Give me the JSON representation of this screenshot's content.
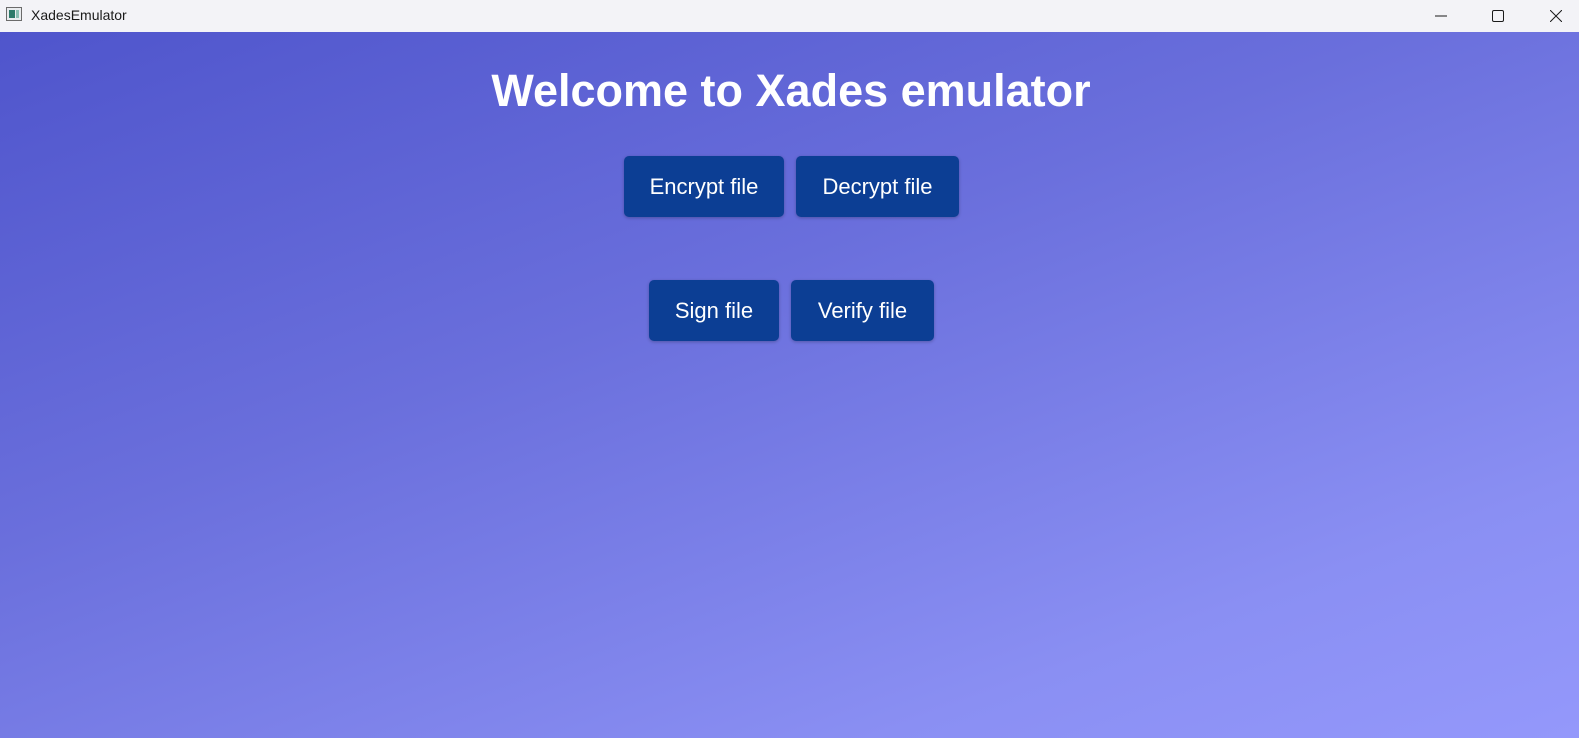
{
  "window": {
    "title": "XadesEmulator",
    "controls": {
      "minimize_icon": "minimize-icon",
      "maximize_icon": "maximize-icon",
      "close_icon": "close-icon"
    }
  },
  "main": {
    "heading": "Welcome to Xades emulator",
    "buttons": {
      "encrypt": "Encrypt file",
      "decrypt": "Decrypt file",
      "sign": "Sign file",
      "verify": "Verify file"
    }
  },
  "colors": {
    "background_start": "#4f55cc",
    "background_end": "#9498fb",
    "button": "#0c3e94",
    "heading_text": "#ffffff"
  }
}
